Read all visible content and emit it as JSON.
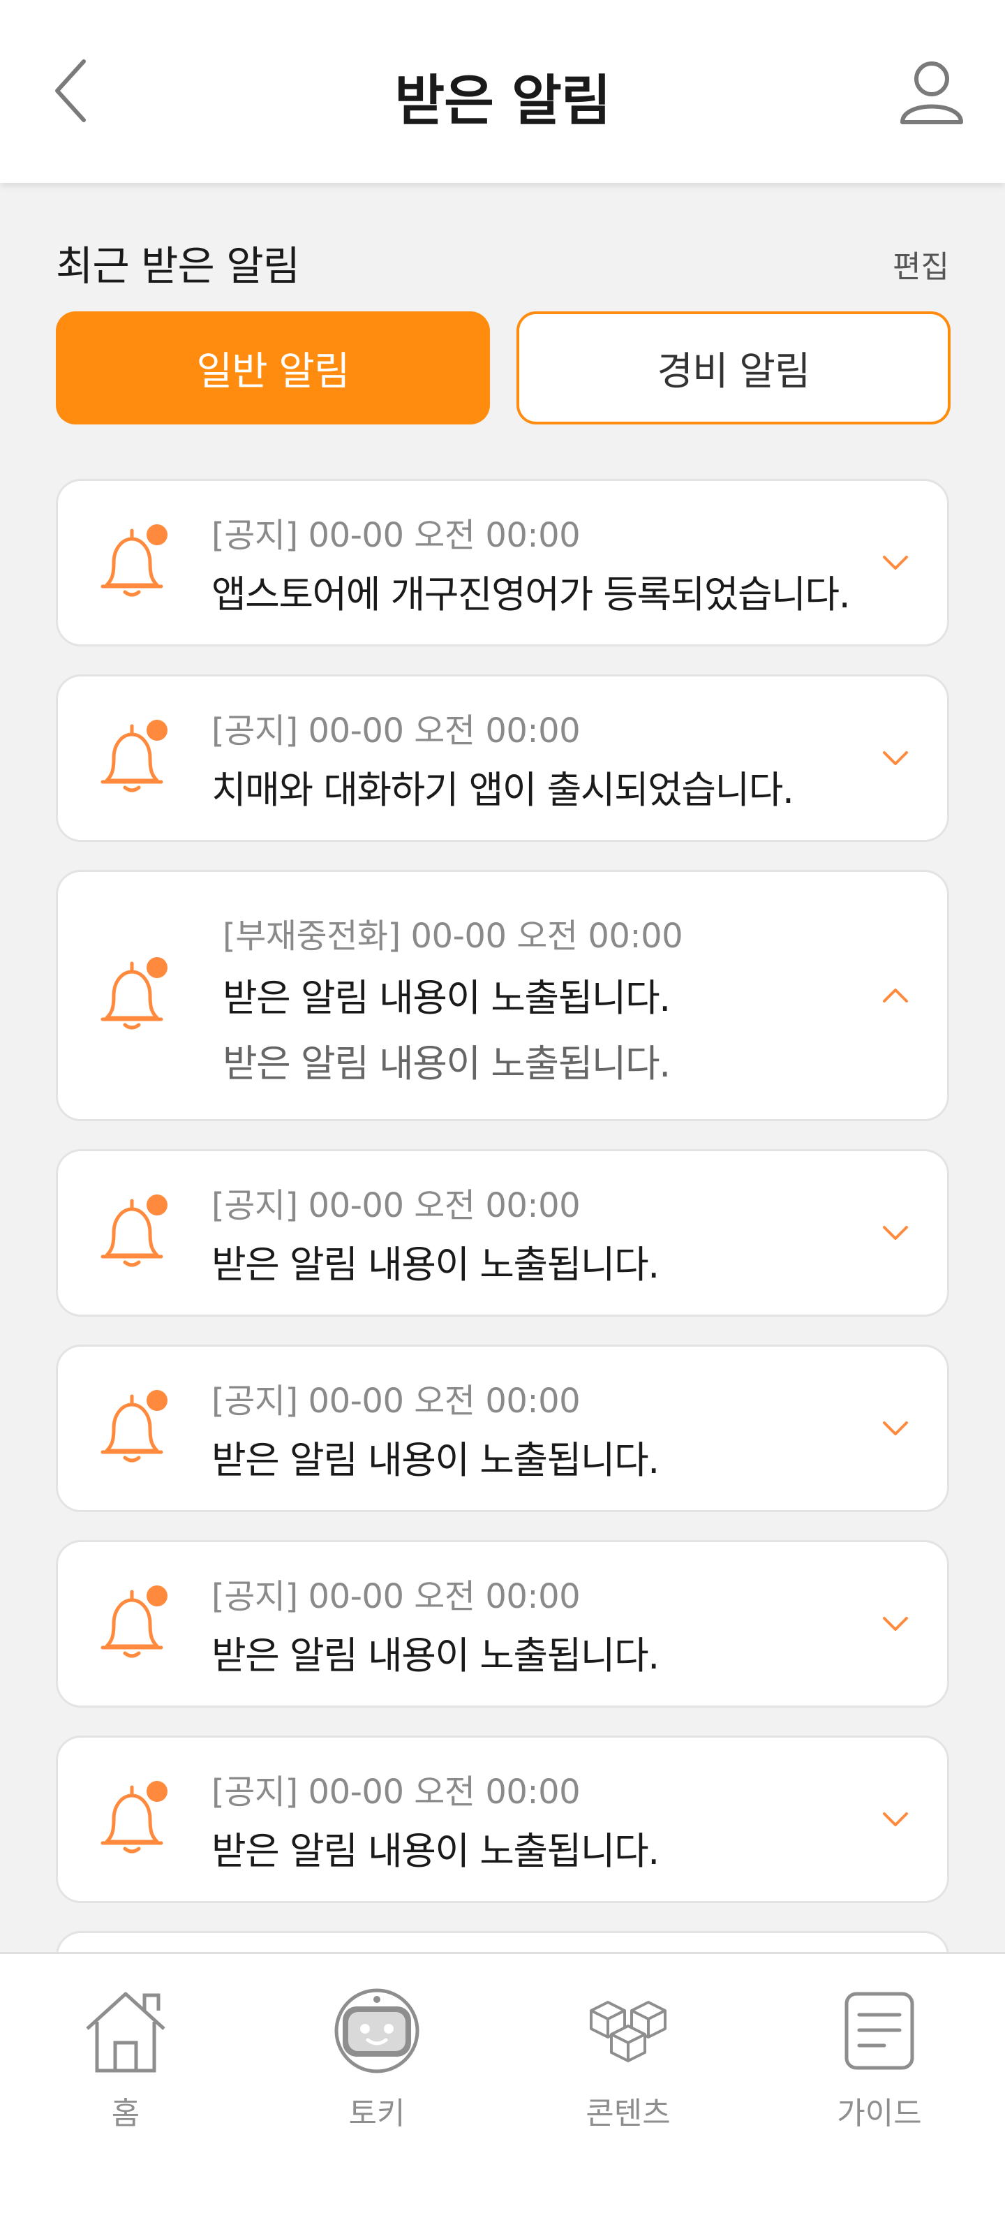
{
  "header": {
    "title": "받은 알림",
    "back_icon": "back-chevron-icon",
    "profile_icon": "user-profile-icon"
  },
  "section": {
    "title": "최근 받은 알림",
    "edit_label": "편집"
  },
  "tabs": [
    {
      "label": "일반 알림",
      "active": true
    },
    {
      "label": "경비 알림",
      "active": false
    }
  ],
  "notifications": [
    {
      "meta": "[공지] 00-00 오전 00:00",
      "message": "앱스토어에 개구진영어가 등록되었습니다.",
      "detail": "",
      "expanded": false,
      "unread": true
    },
    {
      "meta": "[공지] 00-00 오전 00:00",
      "message": "치매와 대화하기 앱이 출시되었습니다.",
      "detail": "",
      "expanded": false,
      "unread": true
    },
    {
      "meta": "[부재중전화] 00-00 오전 00:00",
      "message": "받은 알림 내용이 노출됩니다.",
      "detail": "받은 알림 내용이 노출됩니다.",
      "expanded": true,
      "unread": true
    },
    {
      "meta": "[공지] 00-00 오전 00:00",
      "message": "받은 알림 내용이 노출됩니다.",
      "detail": "",
      "expanded": false,
      "unread": true
    },
    {
      "meta": "[공지] 00-00 오전 00:00",
      "message": "받은 알림 내용이 노출됩니다.",
      "detail": "",
      "expanded": false,
      "unread": true
    },
    {
      "meta": "[공지] 00-00 오전 00:00",
      "message": "받은 알림 내용이 노출됩니다.",
      "detail": "",
      "expanded": false,
      "unread": true
    },
    {
      "meta": "[공지] 00-00 오전 00:00",
      "message": "받은 알림 내용이 노출됩니다.",
      "detail": "",
      "expanded": false,
      "unread": true
    }
  ],
  "bottom_nav": [
    {
      "label": "홈",
      "icon": "home-icon"
    },
    {
      "label": "토키",
      "icon": "robot-face-icon"
    },
    {
      "label": "콘텐츠",
      "icon": "cubes-icon"
    },
    {
      "label": "가이드",
      "icon": "document-icon"
    }
  ],
  "colors": {
    "accent": "#ff8c0f",
    "bell": "#ff8a3d",
    "background": "#f2f2f2"
  }
}
